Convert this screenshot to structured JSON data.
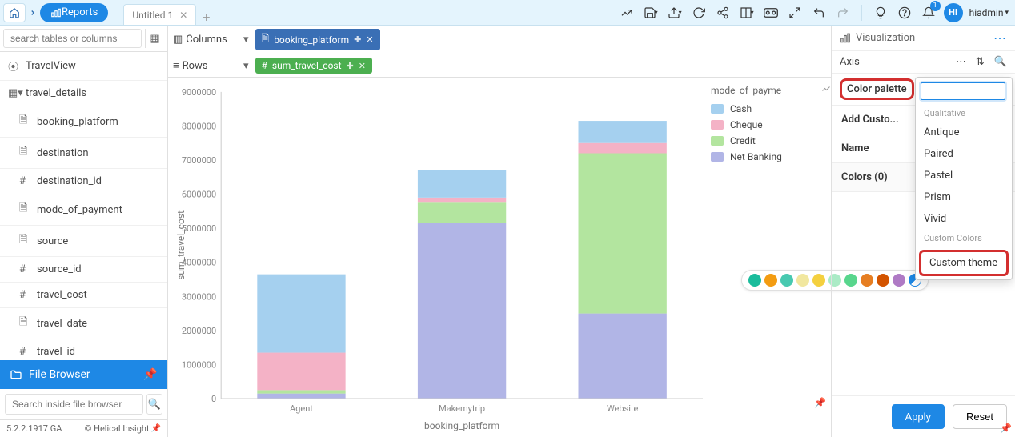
{
  "breadcrumb": {
    "reports": "Reports"
  },
  "tab": {
    "title": "Untitled 1"
  },
  "user": {
    "initials": "HI",
    "name": "hiadmin"
  },
  "left": {
    "search_placeholder": "search tables or columns",
    "items": [
      {
        "icon": "⦿",
        "label": "TravelView",
        "level": 1
      },
      {
        "icon": "▦▾",
        "label": "travel_details",
        "level": 1
      },
      {
        "icon": "🗎",
        "label": "booking_platform",
        "level": 2
      },
      {
        "icon": "🗎",
        "label": "destination",
        "level": 2
      },
      {
        "icon": "#",
        "label": "destination_id",
        "level": 2
      },
      {
        "icon": "🗎",
        "label": "mode_of_payment",
        "level": 2
      },
      {
        "icon": "🗎",
        "label": "source",
        "level": 2
      },
      {
        "icon": "#",
        "label": "source_id",
        "level": 2
      },
      {
        "icon": "#",
        "label": "travel_cost",
        "level": 2
      },
      {
        "icon": "🗎",
        "label": "travel_date",
        "level": 2
      },
      {
        "icon": "#",
        "label": "travel_id",
        "level": 2
      }
    ],
    "file_browser": "File Browser",
    "fb_search_placeholder": "Search inside file browser"
  },
  "footer": {
    "version": "5.2.2.1917 GA",
    "copyright": "© Helical Insight"
  },
  "shelf": {
    "columns_label": "Columns",
    "rows_label": "Rows",
    "column_pill": "booking_platform",
    "row_pill": "sum_travel_cost"
  },
  "legend": {
    "title": "mode_of_payme",
    "items": [
      {
        "label": "Cash",
        "color": "#a5d0ef"
      },
      {
        "label": "Cheque",
        "color": "#f4b2c6"
      },
      {
        "label": "Credit",
        "color": "#b3e59f"
      },
      {
        "label": "Net Banking",
        "color": "#b1b5e6"
      }
    ]
  },
  "right": {
    "visualization": "Visualization",
    "axis": "Axis",
    "color_palette": "Color palette",
    "add_custom": "Add Custo...",
    "name": "Name",
    "colors": "Colors (0)",
    "apply": "Apply",
    "reset": "Reset"
  },
  "dropdown": {
    "section1": "Qualitative",
    "items1": [
      "Antique",
      "Paired",
      "Pastel",
      "Prism",
      "Vivid"
    ],
    "section2": "Custom Colors",
    "custom_theme": "Custom theme"
  },
  "palette_colors": [
    "#1abc9c",
    "#f39c12",
    "#48c9b0",
    "#f1e79f",
    "#f4d03f",
    "#abebc6",
    "#58d68d",
    "#e67e22",
    "#d35400",
    "#af7ac5"
  ],
  "chart_data": {
    "type": "bar",
    "stacked": true,
    "xlabel": "booking_platform",
    "ylabel": "sum_travel_cost",
    "categories": [
      "Agent",
      "Makemytrip",
      "Website"
    ],
    "ylim": [
      0,
      9000000
    ],
    "yticks": [
      0,
      1000000,
      2000000,
      3000000,
      4000000,
      5000000,
      6000000,
      7000000,
      8000000,
      9000000
    ],
    "series": [
      {
        "name": "Net Banking",
        "color": "#b1b5e6",
        "values": [
          150000,
          5150000,
          2500000
        ]
      },
      {
        "name": "Credit",
        "color": "#b3e59f",
        "values": [
          100000,
          600000,
          4700000
        ]
      },
      {
        "name": "Cheque",
        "color": "#f4b2c6",
        "values": [
          1100000,
          150000,
          300000
        ]
      },
      {
        "name": "Cash",
        "color": "#a5d0ef",
        "values": [
          2300000,
          800000,
          650000
        ]
      }
    ]
  }
}
